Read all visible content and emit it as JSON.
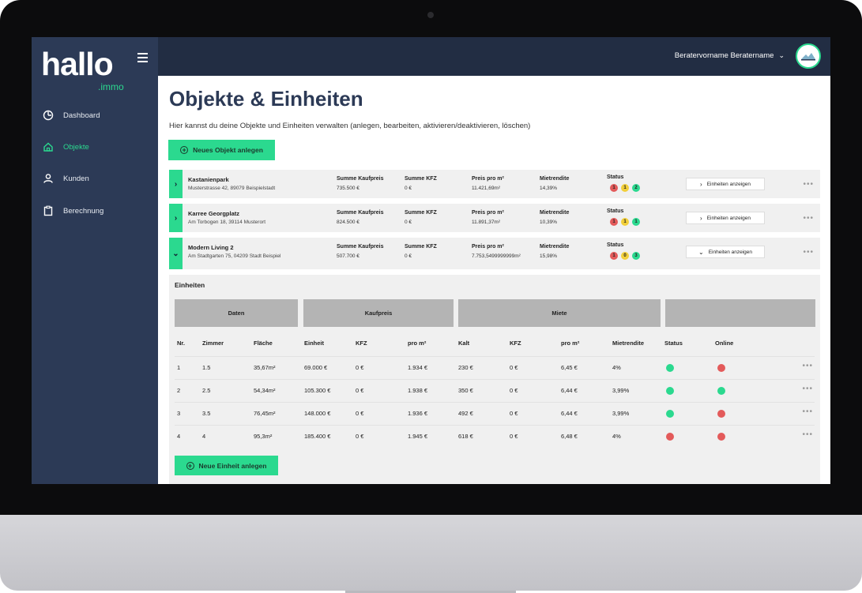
{
  "app": {
    "logo": "hallo",
    "logo_sub": ".immo",
    "user_name": "Beratervorname Beratername"
  },
  "sidebar": {
    "items": [
      {
        "label": "Dashboard",
        "icon": "clock-icon",
        "active": false
      },
      {
        "label": "Objekte",
        "icon": "home-icon",
        "active": true
      },
      {
        "label": "Kunden",
        "icon": "user-icon",
        "active": false
      },
      {
        "label": "Berechnung",
        "icon": "clipboard-icon",
        "active": false
      }
    ]
  },
  "page": {
    "title": "Objekte & Einheiten",
    "description": "Hier kannst du deine Objekte und Einheiten verwalten (anlegen, bearbeiten, aktivieren/deaktivieren, löschen)",
    "new_object_label": "Neues Objekt anlegen"
  },
  "column_headers": {
    "kaufpreis": "Summe Kaufpreis",
    "kfz": "Summe KFZ",
    "preis_qm": "Preis pro m²",
    "mietrendite": "Mietrendite",
    "status": "Status"
  },
  "objects": [
    {
      "name": "Kastanienpark",
      "address": "Musterstrasse 42, 89079 Beispielstadt",
      "kaufpreis": "735.500 €",
      "kfz": "0 €",
      "preis_qm": "11.421,69m²",
      "mietrendite": "14,39%",
      "status_counts": [
        "1",
        "1",
        "2"
      ],
      "units_button": "Einheiten anzeigen",
      "expanded": false
    },
    {
      "name": "Karree Georgplatz",
      "address": "Am Torbogen 18, 39114 Musterort",
      "kaufpreis": "824.500 €",
      "kfz": "0 €",
      "preis_qm": "11.891,37m²",
      "mietrendite": "10,39%",
      "status_counts": [
        "1",
        "1",
        "1"
      ],
      "units_button": "Einheiten anzeigen",
      "expanded": false
    },
    {
      "name": "Modern Living 2",
      "address": "Am Stadtgarten 75, 04209 Stadt Beispiel",
      "kaufpreis": "507.700 €",
      "kfz": "0 €",
      "preis_qm": "7.753,5499999999m²",
      "mietrendite": "15,98%",
      "status_counts": [
        "1",
        "0",
        "3"
      ],
      "units_button": "Einheiten anzeigen",
      "expanded": true
    }
  ],
  "status_colors": {
    "red": "#e35a5a",
    "yellow": "#f2cf3a",
    "green": "#2bd98f"
  },
  "units": {
    "title": "Einheiten",
    "groups": [
      "Daten",
      "Kaufpreis",
      "Miete",
      ""
    ],
    "headers": [
      "Nr.",
      "Zimmer",
      "Fläche",
      "Einheit",
      "KFZ",
      "pro m²",
      "Kalt",
      "KFZ",
      "pro m²",
      "Mietrendite",
      "Status",
      "Online"
    ],
    "rows": [
      {
        "nr": "1",
        "zimmer": "1.5",
        "flaeche": "35,67m²",
        "einheit": "69.000 €",
        "kfz": "0 €",
        "pro_qm": "1.934 €",
        "kalt": "230 €",
        "miete_kfz": "0 €",
        "miete_qm": "6,45 €",
        "rendite": "4%",
        "status": "green",
        "online": "red"
      },
      {
        "nr": "2",
        "zimmer": "2.5",
        "flaeche": "54,34m²",
        "einheit": "105.300 €",
        "kfz": "0 €",
        "pro_qm": "1.938 €",
        "kalt": "350 €",
        "miete_kfz": "0 €",
        "miete_qm": "6,44 €",
        "rendite": "3,99%",
        "status": "green",
        "online": "green"
      },
      {
        "nr": "3",
        "zimmer": "3.5",
        "flaeche": "76,45m²",
        "einheit": "148.000 €",
        "kfz": "0 €",
        "pro_qm": "1.936 €",
        "kalt": "492 €",
        "miete_kfz": "0 €",
        "miete_qm": "6,44 €",
        "rendite": "3,99%",
        "status": "green",
        "online": "red"
      },
      {
        "nr": "4",
        "zimmer": "4",
        "flaeche": "95,3m²",
        "einheit": "185.400 €",
        "kfz": "0 €",
        "pro_qm": "1.945 €",
        "kalt": "618 €",
        "miete_kfz": "0 €",
        "miete_qm": "6,48 €",
        "rendite": "4%",
        "status": "red",
        "online": "red"
      }
    ],
    "new_unit_label": "Neue Einheit anlegen"
  }
}
